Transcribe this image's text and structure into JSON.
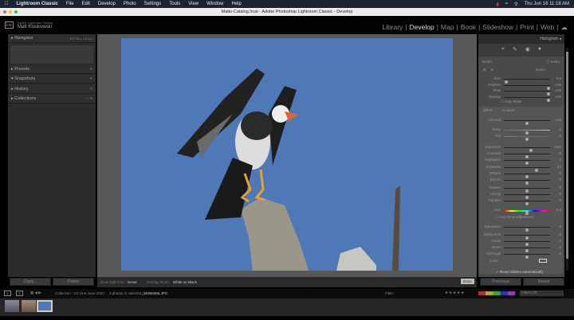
{
  "menubar": {
    "app": "Lightroom Classic",
    "items": [
      "File",
      "Edit",
      "Develop",
      "Photo",
      "Settings",
      "Tools",
      "View",
      "Window",
      "Help"
    ],
    "clock": "Thu Jun 16 11:18 AM"
  },
  "window": {
    "title": "Matts-Catalog.lrcat - Adobe Photoshop Lightroom Classic - Develop"
  },
  "identity": {
    "small": "Adobe Lightroom Classic",
    "name": "Matt Kloskowski",
    "logo": "Lrc"
  },
  "modules": [
    "Library",
    "Develop",
    "Map",
    "Book",
    "Slideshow",
    "Print",
    "Web"
  ],
  "left": {
    "navigator": "Navigator",
    "nav_opts": "FIT  FILL  1:1  3:1",
    "presets": "Presets",
    "snapshots": "Snapshots",
    "history": "History",
    "collections": "Collections",
    "copy": "Copy...",
    "paste": "Paste"
  },
  "right": {
    "histogram": "Histogram",
    "brush": "Brush",
    "invert": "Invert",
    "a": "A",
    "b": "B",
    "erase": "Erase",
    "auto_mask": "Auto Mask",
    "effect": "Effect",
    "custom": "Custom",
    "fine": "Use Fine Adjustment",
    "color": "Color",
    "reset_auto": "Reset Sliders Automatically",
    "previous": "Previous",
    "reset": "Reset",
    "sliders": [
      {
        "label": "Size",
        "value": "4.0",
        "frac": 0.05
      },
      {
        "label": "Feather",
        "value": "100",
        "frac": 0.97
      },
      {
        "label": "Flow",
        "value": "100",
        "frac": 0.97
      },
      {
        "label": "Density",
        "value": "100",
        "frac": 0.97
      },
      {
        "label": "Amount",
        "value": "100",
        "frac": 0.5
      },
      {
        "label": "Temp",
        "value": "0",
        "frac": 0.5
      },
      {
        "label": "Tint",
        "value": "0",
        "frac": 0.5
      },
      {
        "label": "Exposure",
        "value": "0.82",
        "frac": 0.58
      },
      {
        "label": "Contrast",
        "value": "0",
        "frac": 0.5
      },
      {
        "label": "Highlights",
        "value": "0",
        "frac": 0.5
      },
      {
        "label": "Shadows",
        "value": "40",
        "frac": 0.7
      },
      {
        "label": "Whites",
        "value": "0",
        "frac": 0.5
      },
      {
        "label": "Blacks",
        "value": "0",
        "frac": 0.5
      },
      {
        "label": "Texture",
        "value": "0",
        "frac": 0.5
      },
      {
        "label": "Clarity",
        "value": "0",
        "frac": 0.5
      },
      {
        "label": "Dehaze",
        "value": "0",
        "frac": 0.5
      },
      {
        "label": "Hue",
        "value": "0.0",
        "frac": 0.5
      },
      {
        "label": "Saturation",
        "value": "0",
        "frac": 0.5
      },
      {
        "label": "Sharpness",
        "value": "0",
        "frac": 0.5
      },
      {
        "label": "Noise",
        "value": "0",
        "frac": 0.5
      },
      {
        "label": "Moire",
        "value": "0",
        "frac": 0.5
      },
      {
        "label": "Defringe",
        "value": "0",
        "frac": 0.5
      }
    ]
  },
  "toolbar": {
    "show_pins_label": "Show Edit Pins :",
    "show_pins": "Never",
    "overlay_label": "Overlay Mode :",
    "overlay": "White on Black",
    "done": "Done"
  },
  "filmstrip": {
    "source": "Collection : LR 15-6 June 2022",
    "count": "3 photos /1 selected /",
    "file": "_MXB8066.JPG",
    "filter": "Filter :",
    "filters_off": "Filters Off"
  }
}
